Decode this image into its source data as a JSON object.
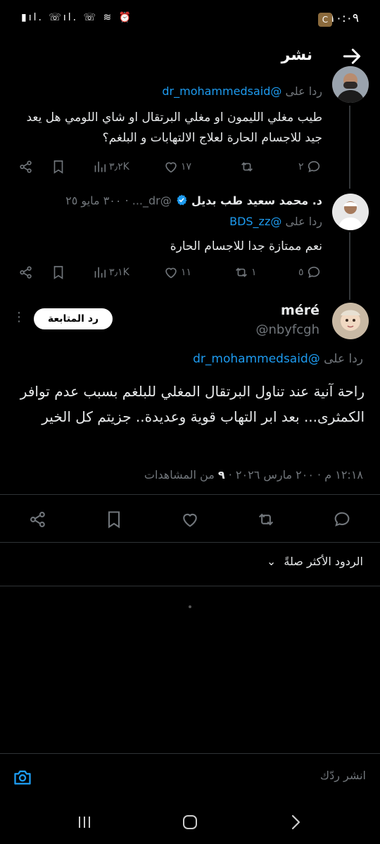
{
  "status_bar": {
    "time": "١٠:٠٩",
    "app_badge": "C",
    "system_icons": "▮ıl. ☏ıl. ☏ ≋ ⏰"
  },
  "header": {
    "title": "نشر",
    "back_icon": "arrow-right-icon"
  },
  "tweets": [
    {
      "reply_prefix": "ردا على",
      "reply_handle": "@dr_mohammedsaid",
      "text": "طيب مغلي الليمون او مغلي البرتقال او شاي اللومي هل يعد جيد للاجسام الحارة لعلاج الالتهابات و البلغم؟",
      "replies": "٢",
      "retweets": "",
      "likes": "١٧",
      "views": "٣٫٢K"
    },
    {
      "author_name": "د. محمد سعيد طب بديل",
      "author_handle": "@dr_...",
      "date": "٣٠٠ مايو ٢٥",
      "date_sep": "·",
      "reply_prefix": "ردا على",
      "reply_handle": "@BDS_zz",
      "text": "نعم ممتازة جدا للاجسام الحارة",
      "replies": "٥",
      "retweets": "١",
      "likes": "١١",
      "views": "٣٫١K"
    }
  ],
  "main_tweet": {
    "author_name": "méré",
    "author_handle": "@nbyfcgh",
    "follow_label": "رد المتابعة",
    "more_label": "⋮",
    "reply_prefix": "ردا على",
    "reply_handle": "@dr_mohammedsaid",
    "text": "راحة آنية عند تناول البرتقال المغلي للبلغم بسبب عدم توافر الكمثرى... بعد ابر التهاب قوية وعديدة.. جزيتم كل الخير",
    "meta_time": "١٢:١٨ م",
    "meta_sep": "·",
    "meta_date": "٢٠٠ مارس ٢٠٢٦",
    "meta_views": "٩",
    "meta_views_label": "من المشاهدات"
  },
  "sort": {
    "label": "الردود الأكثر صلةً",
    "chevron": "⌄"
  },
  "compose": {
    "placeholder": "انشر ردّك"
  },
  "colors": {
    "background": "#000000",
    "text": "#e7e9ea",
    "muted": "#71767b",
    "link": "#1d9bf0",
    "verified": "#1d9bf0"
  }
}
